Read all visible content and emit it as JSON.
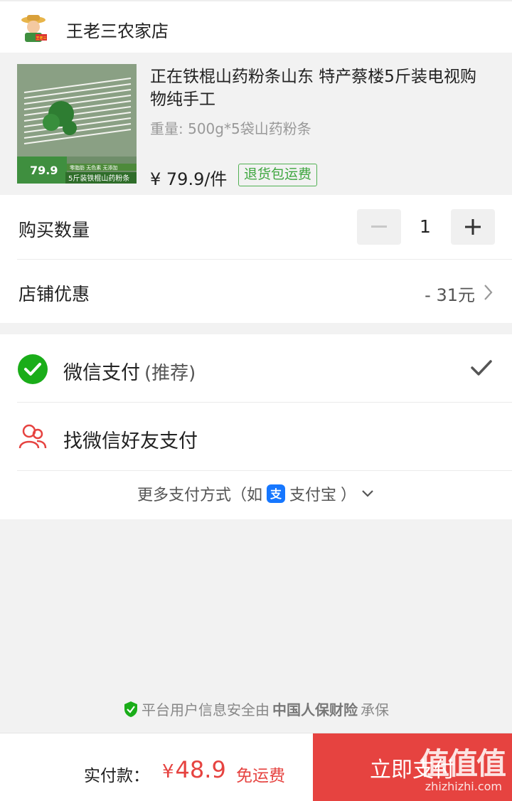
{
  "shop": {
    "name": "王老三农家店",
    "avatar_icon": "farmer-avatar-icon",
    "avatar_badge": "王老三"
  },
  "product": {
    "title": "正在铁棍山药粉条山东 特产蔡楼5斤装电视购物纯手工",
    "spec": "重量: 500g*5袋山药粉条",
    "price": "¥ 79.9/件",
    "tag": "退货包运费",
    "thumb_texts": {
      "price": "79.9",
      "badges": "零脂肪 无色素 无添加",
      "banner": "5斤装铁棍山药粉条"
    }
  },
  "quantity": {
    "label": "购买数量",
    "value": "1",
    "minus": "−",
    "plus": "+"
  },
  "discount": {
    "label": "店铺优惠",
    "value": "- 31元"
  },
  "payment": {
    "wechat": {
      "label": "微信支付",
      "sub": "(推荐)",
      "selected": true
    },
    "friend": {
      "label": "找微信好友支付"
    },
    "more": {
      "prefix": "更多支付方式（如",
      "alipay": "支付宝",
      "suffix": "）"
    }
  },
  "insurance": {
    "prefix": "平台用户信息安全由",
    "company": "中国人保财险",
    "suffix": "承保"
  },
  "bottom": {
    "total_label": "实付款：",
    "currency": "¥",
    "amount": "48.9",
    "shipping": "免运费",
    "pay_button": "立即支付"
  },
  "watermark": {
    "big": "值值值",
    "small": "zhizhizhi.com"
  },
  "colors": {
    "accent_red": "#e64340",
    "wechat_green": "#1aad19",
    "tag_green": "#3ea63f",
    "alipay_blue": "#1677ff"
  }
}
